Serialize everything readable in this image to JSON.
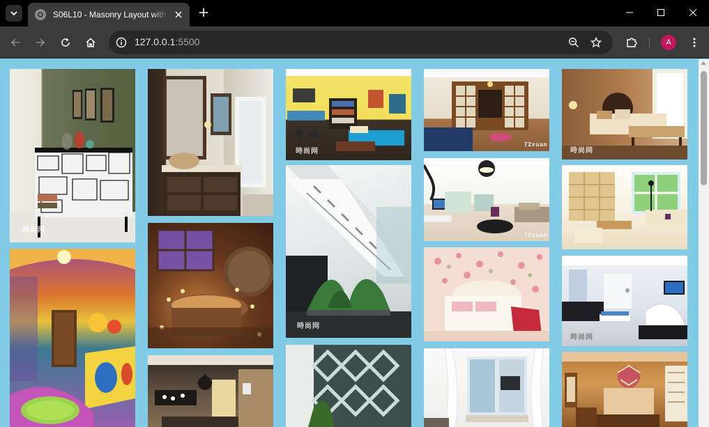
{
  "browser": {
    "tab_title": "S06L10 - Masonry Layout with",
    "url_host": "127.0.0.1",
    "url_port": ":5500",
    "profile_initial": "A"
  },
  "gallery": {
    "watermark": "時尚网",
    "alt_watermark": "72xuan",
    "photos": [
      {
        "subject": "manga-decorated sideboard with glass jars and framed pictures"
      },
      {
        "subject": "colorful mosaic bathroom with yellow bathtub"
      },
      {
        "subject": "bathroom with vessel sink and dark wood vanity"
      },
      {
        "subject": "wooden round bathtub lit by candles"
      },
      {
        "subject": "bedroom with chandelier and dark wood"
      },
      {
        "subject": "yellow living room with bookshelves and blue sofa"
      },
      {
        "subject": "white staircase with indoor plants"
      },
      {
        "subject": "white lattice screen with plants"
      },
      {
        "subject": "bedroom with french doors and wood floor"
      },
      {
        "subject": "living room with tv and beige sofa"
      },
      {
        "subject": "floral wallpaper bedroom with pink bed"
      },
      {
        "subject": "white bay window room with curtains"
      },
      {
        "subject": "brown bedroom with chaise lounge"
      },
      {
        "subject": "bright living room with wood shelves"
      },
      {
        "subject": "modern white living room with tv"
      },
      {
        "subject": "gold dining room with chandelier"
      }
    ]
  }
}
